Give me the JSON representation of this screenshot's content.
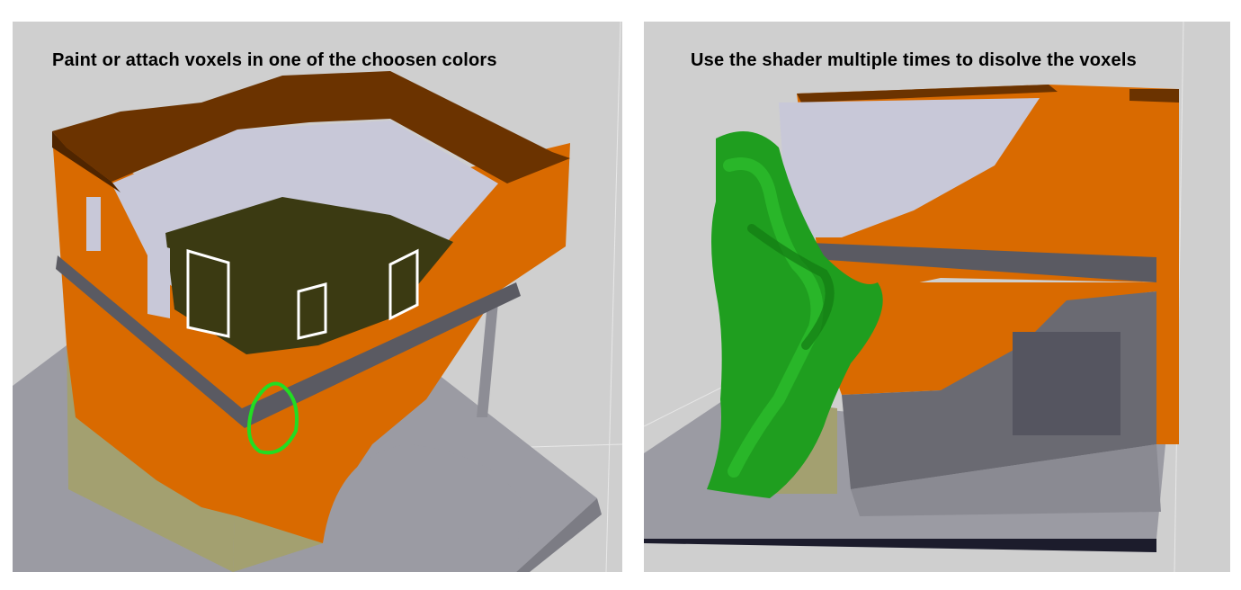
{
  "panels": [
    {
      "caption": "Paint or attach voxels in one of the choosen colors"
    },
    {
      "caption": "Use the shader multiple times to disolve the voxels"
    }
  ],
  "colors": {
    "viewport_background": "#cfcfcf",
    "ground_plate": "#9b9ba3",
    "roof": "#6b3300",
    "brick_orange": "#d96a00",
    "foundation_olive": "#9e9a6a",
    "interior_wall": "#c8c8d8",
    "interior_floor": "#3b3a12",
    "beam": "#5a5a62",
    "brush_ring": "#22dd22",
    "ivy_green": "#1f9e1f",
    "dark_interior": "#6a6a72"
  }
}
